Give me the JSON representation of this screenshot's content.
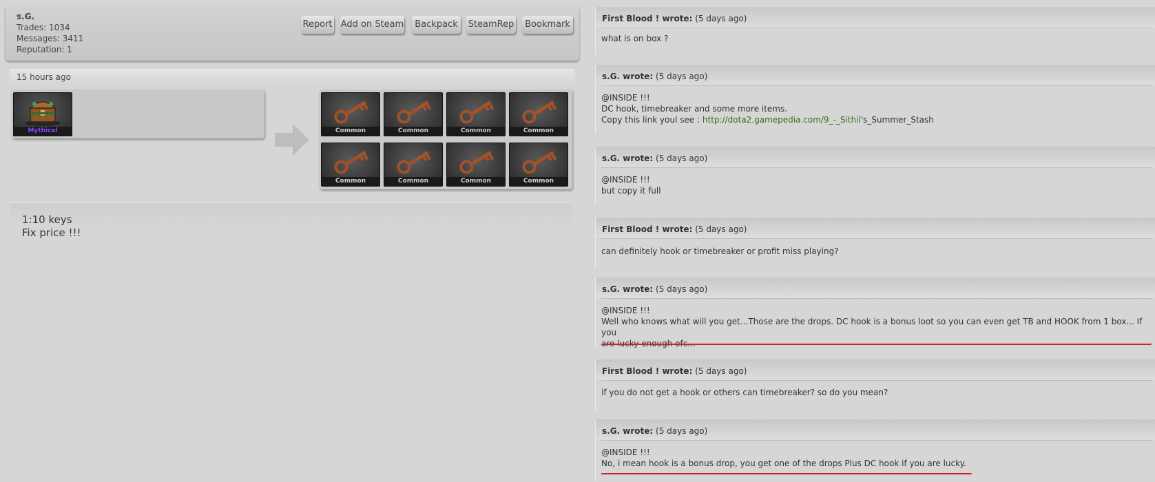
{
  "profile": {
    "name": "s.G.",
    "trades": "Trades: 1034",
    "messages": "Messages: 3411",
    "reputation": "Reputation: 1",
    "buttons": [
      "Report",
      "Add on Steam",
      "Backpack",
      "SteamRep",
      "Bookmark"
    ]
  },
  "trade": {
    "posted": "15 hours ago",
    "have_items": [
      {
        "rarity": "Mythical",
        "icon": "treasure-chest"
      }
    ],
    "want_items": [
      {
        "rarity": "Common",
        "icon": "key"
      },
      {
        "rarity": "Common",
        "icon": "key"
      },
      {
        "rarity": "Common",
        "icon": "key"
      },
      {
        "rarity": "Common",
        "icon": "key"
      },
      {
        "rarity": "Common",
        "icon": "key"
      },
      {
        "rarity": "Common",
        "icon": "key"
      },
      {
        "rarity": "Common",
        "icon": "key"
      },
      {
        "rarity": "Common",
        "icon": "key"
      }
    ],
    "notes": [
      "1:10 keys",
      "Fix price !!!"
    ]
  },
  "comments": [
    {
      "author": "First Blood ! wrote:",
      "time": "(5 days ago)",
      "lines": [
        "what is on box ?"
      ]
    },
    {
      "author": "s.G. wrote:",
      "time": "(5 days ago)",
      "lines": [
        "@INSIDE !!!",
        "DC hook, timebreaker and some more items."
      ],
      "link_line": {
        "prefix": "Copy this link youl see : ",
        "link": "http://dota2.gamepedia.com/9_-_Sithil",
        "suffix": "'s_Summer_Stash"
      }
    },
    {
      "author": "s.G. wrote:",
      "time": "(5 days ago)",
      "lines": [
        "@INSIDE !!!",
        "but copy it full"
      ]
    },
    {
      "author": "First Blood ! wrote:",
      "time": "(5 days ago)",
      "lines": [
        "can definitely hook or timebreaker or profit miss playing?"
      ]
    },
    {
      "author": "s.G. wrote:",
      "time": "(5 days ago)",
      "lines": [
        "@INSIDE !!!",
        "Well who knows what will you get...Those are the drops. DC hook is a bonus loot so you can even get TB and HOOK from 1 box... If you",
        "are lucky enough ofc..."
      ]
    },
    {
      "author": "First Blood ! wrote:",
      "time": "(5 days ago)",
      "lines": [
        "if you do not get a hook or others can timebreaker? so do you mean?"
      ]
    },
    {
      "author": "s.G. wrote:",
      "time": "(5 days ago)",
      "lines": [
        "@INSIDE !!!",
        "No, i mean hook is a bonus drop, you get one of the drops Plus DC hook if you are lucky."
      ]
    }
  ],
  "colors": {
    "underline": "#d42020",
    "mythical": "#8847ff",
    "link": "#3a6d1a"
  }
}
